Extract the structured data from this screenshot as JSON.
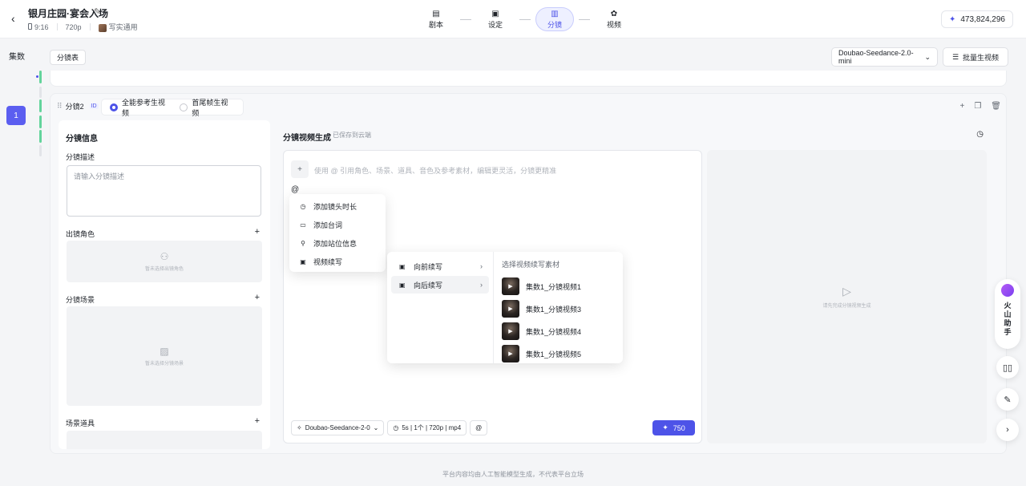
{
  "header": {
    "title": "银月庄园·宴会入场",
    "aspect": "9:16",
    "resolution": "720p",
    "style": "写实通用",
    "steps": [
      {
        "label": "剧本",
        "icon": "▤"
      },
      {
        "label": "设定",
        "icon": "▣"
      },
      {
        "label": "分镜",
        "icon": "▥"
      },
      {
        "label": "视频",
        "icon": "✿"
      }
    ],
    "active_step": "分镜",
    "credits": "473,824,296"
  },
  "rail": {
    "title": "集数",
    "episode": "1"
  },
  "toolbar": {
    "tab": "分镜表",
    "model": "Doubao-Seedance-2.0-mini",
    "batch": "批量生视频"
  },
  "shot": {
    "name": "分镜2",
    "id_badge": "ID",
    "mode_1": "全能参考生视频",
    "mode_2": "首尾帧生视频",
    "info": {
      "title": "分镜信息",
      "desc_label": "分镜描述",
      "desc_placeholder": "请输入分镜描述",
      "char_label": "出镜角色",
      "char_empty": "暂未选择出镜角色",
      "scene_label": "分镜场景",
      "scene_empty": "暂未选择分镜场景",
      "props_label": "场景道具"
    },
    "gen": {
      "title": "分镜视频生成",
      "saved": "已保存到云端",
      "placeholder": "使用 @ 引用角色、场景、道具、音色及参考素材，编辑更灵活，分镜更精准",
      "typed": "@",
      "model_chip": "Doubao-Seedance-2-0",
      "params_chip": "5s | 1个 | 720p | mp4",
      "at_chip": "@",
      "cost": "750",
      "preview_empty": "请先完成分镜视频生成"
    }
  },
  "menu_at": [
    {
      "label": "添加镜头时长",
      "icon": "◷"
    },
    {
      "label": "添加台词",
      "icon": "▭"
    },
    {
      "label": "添加站位信息",
      "icon": "⚲"
    },
    {
      "label": "视频续写",
      "icon": "▣"
    }
  ],
  "menu_continue": {
    "items": [
      "向前续写",
      "向后续写"
    ],
    "hovered": "向后续写",
    "clips_title": "选择视频续写素材",
    "clips": [
      "集数1_分镜视频1",
      "集数1_分镜视频3",
      "集数1_分镜视频4",
      "集数1_分镜视频5"
    ]
  },
  "assistant": {
    "label": "火山助手"
  },
  "footer": "平台内容均由人工智能模型生成，不代表平台立场"
}
